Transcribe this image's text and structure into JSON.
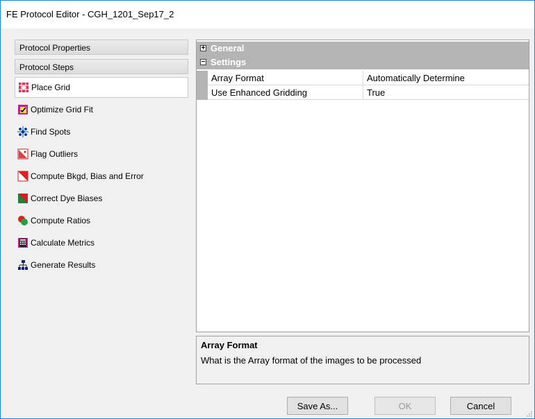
{
  "window": {
    "title": "FE Protocol Editor - CGH_1201_Sep17_2"
  },
  "left_pane": {
    "protocol_properties": "Protocol Properties",
    "protocol_steps": "Protocol Steps",
    "steps": [
      {
        "label": "Place Grid",
        "icon": "place-grid-icon",
        "selected": true
      },
      {
        "label": "Optimize Grid Fit",
        "icon": "optimize-grid-fit-icon"
      },
      {
        "label": "Find Spots",
        "icon": "find-spots-icon"
      },
      {
        "label": "Flag Outliers",
        "icon": "flag-outliers-icon"
      },
      {
        "label": "Compute Bkgd, Bias and Error",
        "icon": "compute-bkgd-icon"
      },
      {
        "label": "Correct Dye Biases",
        "icon": "correct-dye-biases-icon"
      },
      {
        "label": "Compute Ratios",
        "icon": "compute-ratios-icon"
      },
      {
        "label": "Calculate Metrics",
        "icon": "calculate-metrics-icon"
      },
      {
        "label": "Generate Results",
        "icon": "generate-results-icon"
      }
    ]
  },
  "property_grid": {
    "categories": [
      {
        "label": "General",
        "toggle": "+"
      },
      {
        "label": "Settings",
        "toggle": "−"
      }
    ],
    "properties": [
      {
        "name": "Array Format",
        "value": "Automatically Determine"
      },
      {
        "name": "Use Enhanced Gridding",
        "value": "True"
      }
    ]
  },
  "description": {
    "title": "Array Format",
    "text": "What is the Array format of the images to be processed"
  },
  "buttons": {
    "save_as": "Save As...",
    "ok": "OK",
    "cancel": "Cancel"
  }
}
